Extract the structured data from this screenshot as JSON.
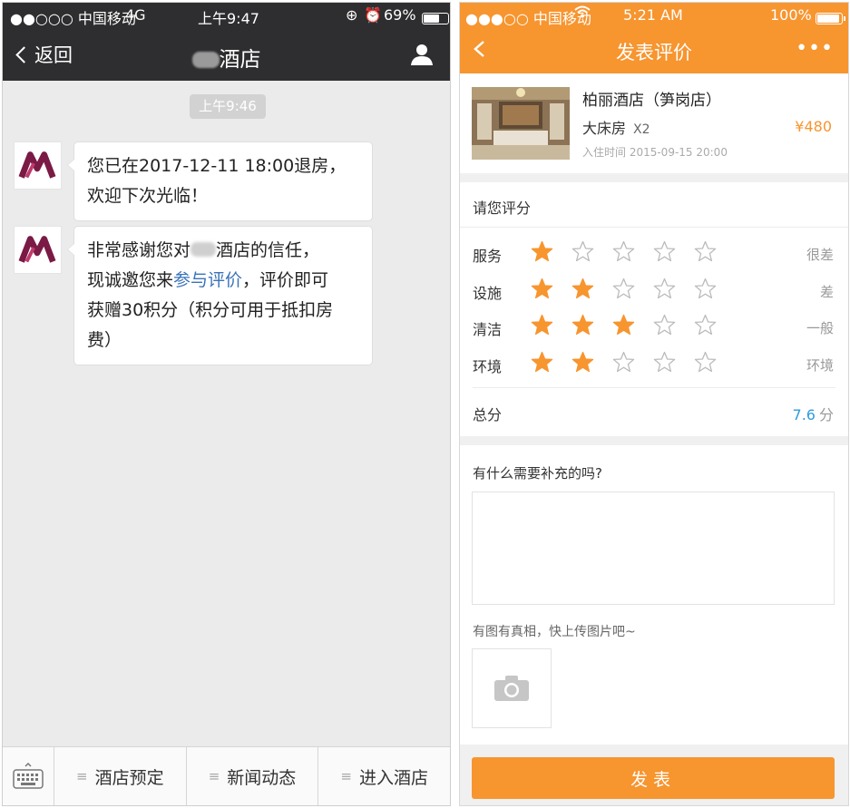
{
  "left": {
    "status": {
      "carrier": "●●○○○ 中国移动",
      "network": "4G",
      "time": "上午9:47",
      "battery": "69%",
      "battery_level": 0.69
    },
    "nav": {
      "back_label": "返回",
      "title_suffix": "酒店"
    },
    "timestamp": "上午9:46",
    "messages": [
      {
        "lines": [
          "您已在2017-12-11 18:00退房，",
          "欢迎下次光临！"
        ]
      },
      {
        "line1_before": "非常感谢您对",
        "line1_after": "酒店的信任，",
        "line2_before": "现诚邀您来",
        "link": "参与评价",
        "line2_after": "，评价即可",
        "line3": "获赠30积分（积分可用于抵扣房",
        "line4": "费）"
      }
    ],
    "menu": [
      "酒店预定",
      "新闻动态",
      "进入酒店"
    ],
    "icons": {
      "keyboard": "keyboard-icon",
      "user": "user-icon",
      "back": "chevron-left-icon"
    }
  },
  "right": {
    "status": {
      "carrier": "●●●○○ 中国移动",
      "time": "5:21 AM",
      "battery": "100%",
      "battery_level": 1.0
    },
    "nav": {
      "title": "发表评价",
      "more": "•••"
    },
    "booking": {
      "hotel_name": "柏丽酒店（笋岗店）",
      "room_type": "大床房",
      "quantity": "X2",
      "price": "¥480",
      "checkin": "入住时间 2015-09-15  20:00"
    },
    "rating": {
      "title": "请您评分",
      "max_stars": 5,
      "items": [
        {
          "label": "服务",
          "stars": 1,
          "level": "很差"
        },
        {
          "label": "设施",
          "stars": 2,
          "level": "差"
        },
        {
          "label": "清洁",
          "stars": 3,
          "level": "一般"
        },
        {
          "label": "环境",
          "stars": 2,
          "level": "环境"
        }
      ],
      "total_label": "总分",
      "total_value": "7.6",
      "total_unit": "分"
    },
    "comment": {
      "title": "有什么需要补充的吗?",
      "placeholder": ""
    },
    "upload": {
      "hint": "有图有真相，快上传图片吧~"
    },
    "submit_label": "发表",
    "colors": {
      "accent": "#f7952f",
      "link": "#3a73b8",
      "total": "#2e9be0",
      "star_empty": "#bbbbbb"
    }
  }
}
